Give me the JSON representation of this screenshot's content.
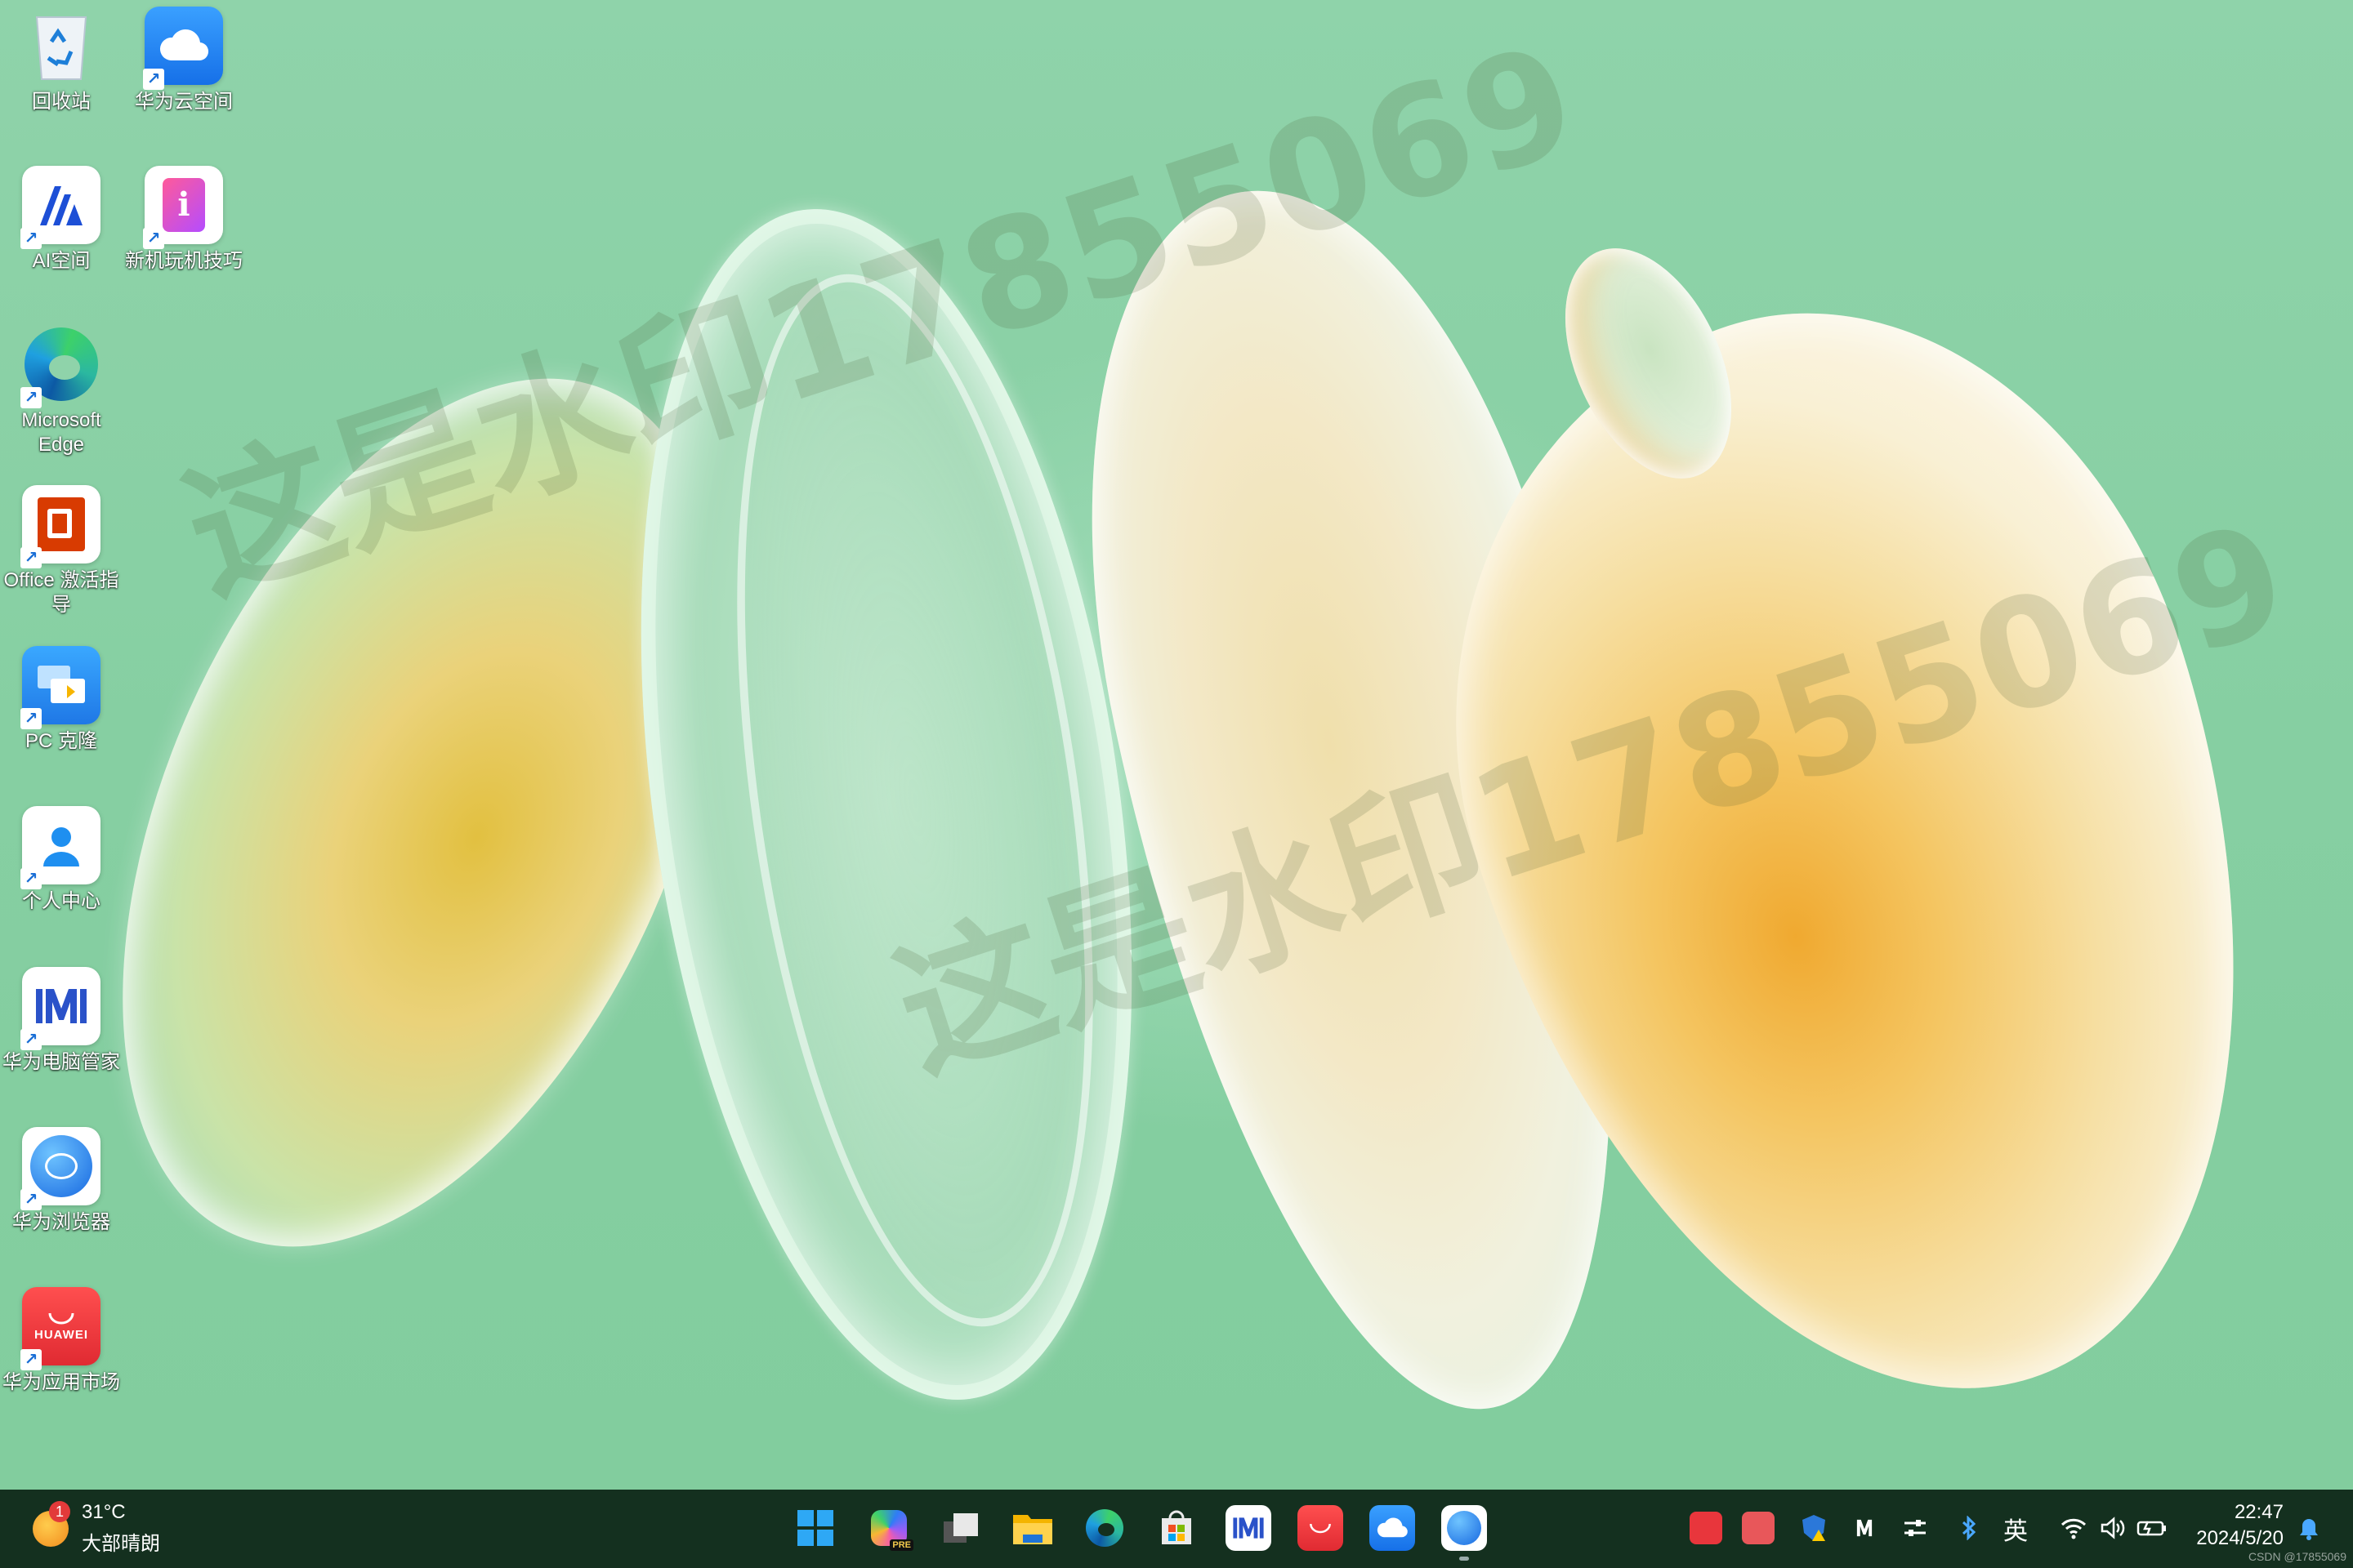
{
  "desktop": {
    "watermark": "这是水印17855069",
    "icons": [
      {
        "id": "recycle",
        "label": "回收站"
      },
      {
        "id": "huawei-cloud",
        "label": "华为云空间"
      },
      {
        "id": "ai-space",
        "label": "AI空间"
      },
      {
        "id": "new-tips",
        "label": "新机玩机技巧"
      },
      {
        "id": "edge",
        "label": "Microsoft Edge"
      },
      {
        "id": "office",
        "label": "Office 激活指导"
      },
      {
        "id": "pc-clone",
        "label": "PC 克隆"
      },
      {
        "id": "personal",
        "label": "个人中心"
      },
      {
        "id": "pc-manager",
        "label": "华为电脑管家"
      },
      {
        "id": "browser",
        "label": "华为浏览器"
      },
      {
        "id": "appgallery",
        "label": "华为应用市场"
      }
    ]
  },
  "taskbar": {
    "weather": {
      "temp": "31°C",
      "desc": "大部晴朗",
      "badge": "1"
    },
    "apps": [
      "start",
      "copilot",
      "task-view",
      "file-explorer",
      "edge",
      "store",
      "pc-manager",
      "appgallery",
      "huawei-cloud",
      "browser"
    ],
    "copilot_badge": "PRE",
    "ime": "英",
    "clock": {
      "time": "22:47",
      "date": "2024/5/20"
    },
    "footer_mark": "CSDN @17855069"
  },
  "colors": {
    "taskbar": "#14301f",
    "accent": "#1b6fd6",
    "huawei_red": "#e8363c"
  }
}
